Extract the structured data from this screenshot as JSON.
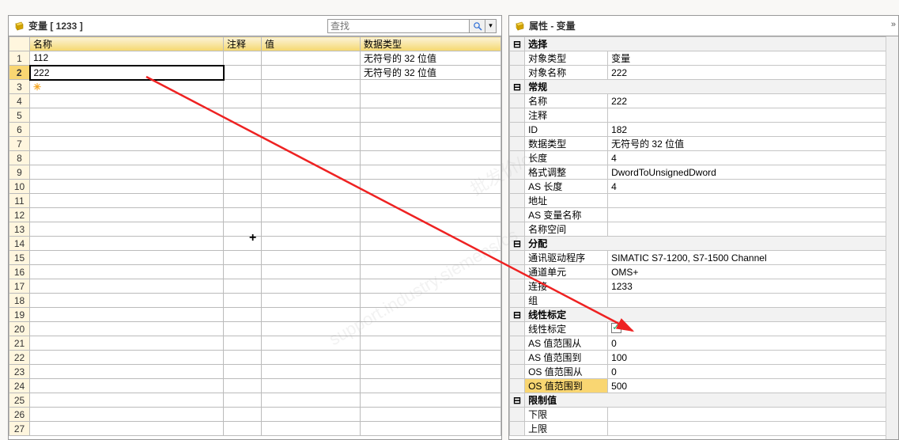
{
  "left": {
    "title": "变量 [ 1233 ]",
    "search_placeholder": "查找",
    "headers": {
      "name": "名称",
      "comment": "注释",
      "value": "值",
      "datatype": "数据类型"
    },
    "rows": [
      {
        "num": "1",
        "name": "112",
        "comment": "",
        "value": "",
        "datatype": "无符号的 32 位值"
      },
      {
        "num": "2",
        "name": "222",
        "comment": "",
        "value": "",
        "datatype": "无符号的 32 位值"
      },
      {
        "num": "3",
        "name": "",
        "comment": "",
        "value": "",
        "datatype": ""
      }
    ],
    "row_count": 27
  },
  "right": {
    "title": "属性 - 变量",
    "sections": {
      "select": {
        "label": "选择",
        "objtype_l": "对象类型",
        "objtype_v": "变量",
        "objname_l": "对象名称",
        "objname_v": "222"
      },
      "general": {
        "label": "常规",
        "name_l": "名称",
        "name_v": "222",
        "comment_l": "注释",
        "comment_v": "",
        "id_l": "ID",
        "id_v": "182",
        "datatype_l": "数据类型",
        "datatype_v": "无符号的 32 位值",
        "len_l": "长度",
        "len_v": "4",
        "fmt_l": "格式调整",
        "fmt_v": "DwordToUnsignedDword",
        "aslen_l": "AS 长度",
        "aslen_v": "4",
        "addr_l": "地址",
        "addr_v": "",
        "asvar_l": "AS 变量名称",
        "asvar_v": "",
        "ns_l": "名称空间",
        "ns_v": ""
      },
      "assign": {
        "label": "分配",
        "drv_l": "通讯驱动程序",
        "drv_v": "SIMATIC S7-1200, S7-1500 Channel",
        "unit_l": "通道单元",
        "unit_v": "OMS+",
        "conn_l": "连接",
        "conn_v": "1233",
        "grp_l": "组",
        "grp_v": ""
      },
      "linear": {
        "label": "线性标定",
        "scale_l": "线性标定",
        "asfrom_l": "AS 值范围从",
        "asfrom_v": "0",
        "asto_l": "AS 值范围到",
        "asto_v": "100",
        "osfrom_l": "OS 值范围从",
        "osfrom_v": "0",
        "osto_l": "OS 值范围到",
        "osto_v": "500"
      },
      "limit": {
        "label": "限制值",
        "low_l": "下限",
        "low_v": "",
        "high_l": "上限",
        "high_v": ""
      }
    }
  }
}
